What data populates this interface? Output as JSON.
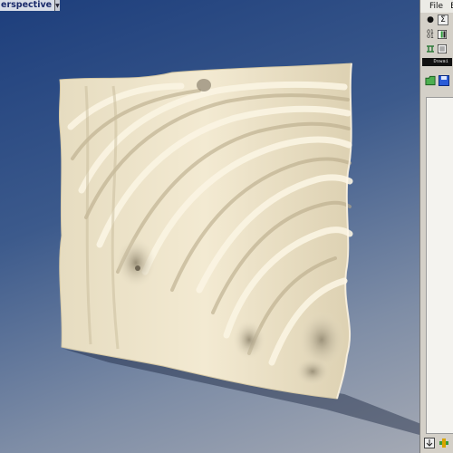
{
  "viewport": {
    "view_label": "erspective",
    "view_dropdown_icon": "chevron-down-icon",
    "background_top": "#1d3e7c",
    "background_bottom": "#a4a9b4",
    "surface_color": "#efe6cc"
  },
  "menu": {
    "items": [
      "File",
      "E"
    ]
  },
  "toolbar": {
    "row1_icons": [
      "record-dot-icon",
      "sigma-icon"
    ],
    "row2_icons": [
      "binary-toggle-icon",
      "panel-icon"
    ],
    "row3_icons": [
      "split-icon",
      "panel-icon-2"
    ],
    "status_text": "Dswai"
  },
  "file_tools": {
    "icons": [
      "open-folder-icon",
      "save-disk-icon"
    ]
  },
  "bottom_tools": {
    "icons": [
      "import-icon",
      "add-component-icon"
    ]
  },
  "accent_color": "#1a2a6a"
}
